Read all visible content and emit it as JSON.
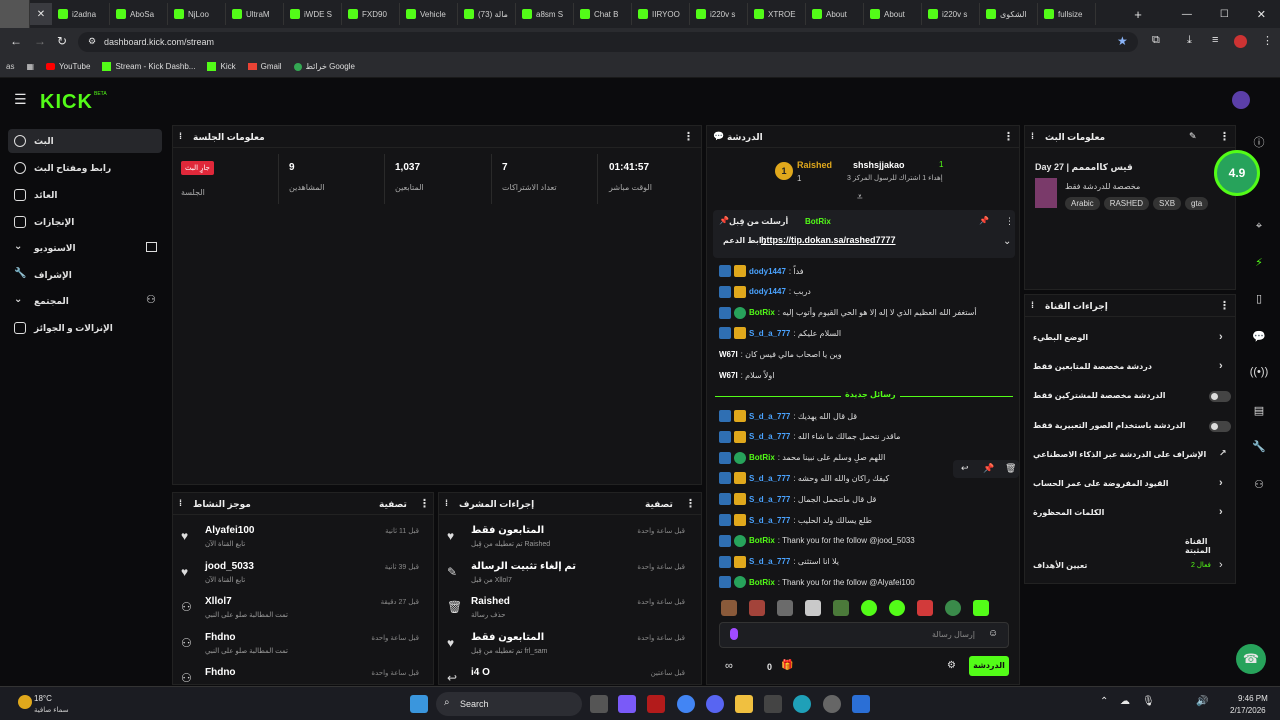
{
  "browser": {
    "tabs": [
      "i2adna",
      "AboSa",
      "NjLoo",
      "UltraM",
      "iWDE S",
      "FXD90",
      "Vehicle",
      "مالة (73)",
      "a8sm S",
      "Chat B",
      "IIRYOO",
      "i220v s",
      "XTROE",
      "About",
      "About",
      "i220v s",
      "الشكوى",
      "fullsize"
    ],
    "url": "dashboard.kick.com/stream",
    "bookmarks": [
      "YouTube",
      "Stream - Kick Dashb...",
      "Kick",
      "Gmail",
      "خرائط Google"
    ],
    "profile": "as"
  },
  "kick": {
    "logo": "KICK",
    "logo_beta": "BETA"
  },
  "sidebar": {
    "items": [
      {
        "label": "البث"
      },
      {
        "label": "رابط ومفتاح البث"
      },
      {
        "label": "العائد"
      },
      {
        "label": "الإنجازات"
      },
      {
        "label": "الاستوديو"
      },
      {
        "label": "الإشراف"
      },
      {
        "label": "المجتمع"
      },
      {
        "label": "الإنزالات و الجوائز"
      }
    ]
  },
  "session": {
    "title": "معلومات الجلسة",
    "live_badge": "جارٍ البث",
    "session_label": "الجلسة",
    "stats": [
      {
        "value": "9",
        "label": "المشاهدين"
      },
      {
        "value": "1,037",
        "label": "المتابعين"
      },
      {
        "value": "7",
        "label": "تعداد الاشتراكات"
      },
      {
        "value": "01:41:57",
        "label": "الوقت مباشر"
      }
    ]
  },
  "activity": {
    "title": "موجز النشاط",
    "filter": "تصفية",
    "rows": [
      {
        "name": "Alyafei100",
        "sub": "تابع القناة الآن",
        "time": "قبل 11 ثانية"
      },
      {
        "name": "jood_5033",
        "sub": "تابع القناة الآن",
        "time": "قبل 39 ثانية"
      },
      {
        "name": "Xllol7",
        "sub": "تمت المطالبة صلو على النبي",
        "time": "قبل 27 دقيقة"
      },
      {
        "name": "Fhdno",
        "sub": "تمت المطالبة صلو على النبي",
        "time": "قبل ساعة واحدة"
      },
      {
        "name": "Fhdno",
        "sub": "",
        "time": "قبل ساعة واحدة"
      }
    ]
  },
  "modactions": {
    "title": "إجراءات المشرف",
    "filter": "تصفية",
    "rows": [
      {
        "name": "المتابعون فقط",
        "sub": "تم تعطيله من قِبل Raished",
        "time": "قبل ساعة واحدة"
      },
      {
        "name": "تم إلغاء تثبيت الرسالة",
        "sub": "من قبل Xllol7",
        "time": "قبل ساعة واحدة"
      },
      {
        "name": "Raished",
        "sub": "حذف رسالة",
        "time": "قبل ساعة واحدة"
      },
      {
        "name": "المتابعون فقط",
        "sub": "تم تعطيله من قِبل frl_sam",
        "time": "قبل ساعة واحدة"
      },
      {
        "name": "i4 O",
        "sub": "",
        "time": "قبل ساعتين"
      }
    ]
  },
  "chat": {
    "title": "الدردشة",
    "top": {
      "user1": "Raished",
      "user1_count": "1",
      "user2": "shshsjjakao",
      "user2_count": "1",
      "sub_text": "إهداء 1 اشتراك للرسول المركز 3",
      "rank": "1"
    },
    "pinned": {
      "header": "أرسلت من قِبل",
      "bot": "BotRix",
      "label": "رابط الدعم",
      "link": "https://tip.dokan.sa/rashed7777"
    },
    "messages": [
      {
        "user": "dody1447",
        "text": ": فداً"
      },
      {
        "user": "dody1447",
        "text": ": دربب"
      },
      {
        "user": "BotRix",
        "text": ": أستغفر الله العظيم الذي لا إله إلا هو الحي القيوم وأتوب إليه"
      },
      {
        "user": "S_d_a_777",
        "text": ": السلام عليكم"
      },
      {
        "user": "W67I",
        "text": ": وين يا اصحاب مالي فيس كان"
      },
      {
        "user": "W67I",
        "text": ": اولاً سلام"
      }
    ],
    "new_divider": "رسائل جديدة",
    "new_messages": [
      {
        "user": "S_d_a_777",
        "text": ": قل قال الله يهديك"
      },
      {
        "user": "S_d_a_777",
        "text": ": ماقدر نتحمل جمالك ما شاء الله"
      },
      {
        "user": "BotRix",
        "text": ": اللهم صلِ وسلم على نبينا محمد"
      },
      {
        "user": "S_d_a_777",
        "text": ": كيفك راكان والله الله وحشه"
      },
      {
        "user": "S_d_a_777",
        "text": ": قل قال ماتتحمل الجمال"
      },
      {
        "user": "S_d_a_777",
        "text": ": طلع يسالك ولد الحليب"
      },
      {
        "user": "BotRix",
        "text": ": Thank you for the follow @jood_5033"
      },
      {
        "user": "S_d_a_777",
        "text": ": يلا انا استثنى"
      },
      {
        "user": "BotRix",
        "text": ": Thank you for the follow @Alyafei100"
      }
    ],
    "input_placeholder": "إرسال رسالة",
    "count": "0",
    "send": "الدردشة"
  },
  "streaminfo": {
    "title": "معلومات البث",
    "stream_title": "Day 27 | قيس كاامممم",
    "category": "مخصصة للدردشة فقط",
    "tags": [
      "Arabic",
      "RASHED",
      "SXB",
      "gta"
    ],
    "rating": "4.9"
  },
  "channel": {
    "title": "إجراءات القناة",
    "rows": [
      {
        "label": "الوضع البطيء",
        "type": "chevron"
      },
      {
        "label": "دردشة مخصصة للمتابعين فقط",
        "type": "chevron"
      },
      {
        "label": "الدردشة مخصصة للمشتركين فقط",
        "type": "toggle"
      },
      {
        "label": "الدردشة باستخدام الصور التعبيرية فقط",
        "type": "toggle"
      },
      {
        "label": "الإشراف على الدردشة عبر الذكاء الاصطناعي",
        "type": "ext"
      },
      {
        "label": "القيود المفروضة على عمر الحساب",
        "type": "chevron"
      },
      {
        "label": "الكلمات المحظورة",
        "type": "chevron"
      }
    ],
    "pinned_section": "القناة المثبتة",
    "goals_label": "تعيين الأهداف",
    "goals_status": "فعال 2"
  },
  "taskbar": {
    "weather_temp": "18°C",
    "weather_desc": "سماء صافية",
    "search": "Search",
    "time": "9:46 PM",
    "date": "2/17/2026"
  }
}
